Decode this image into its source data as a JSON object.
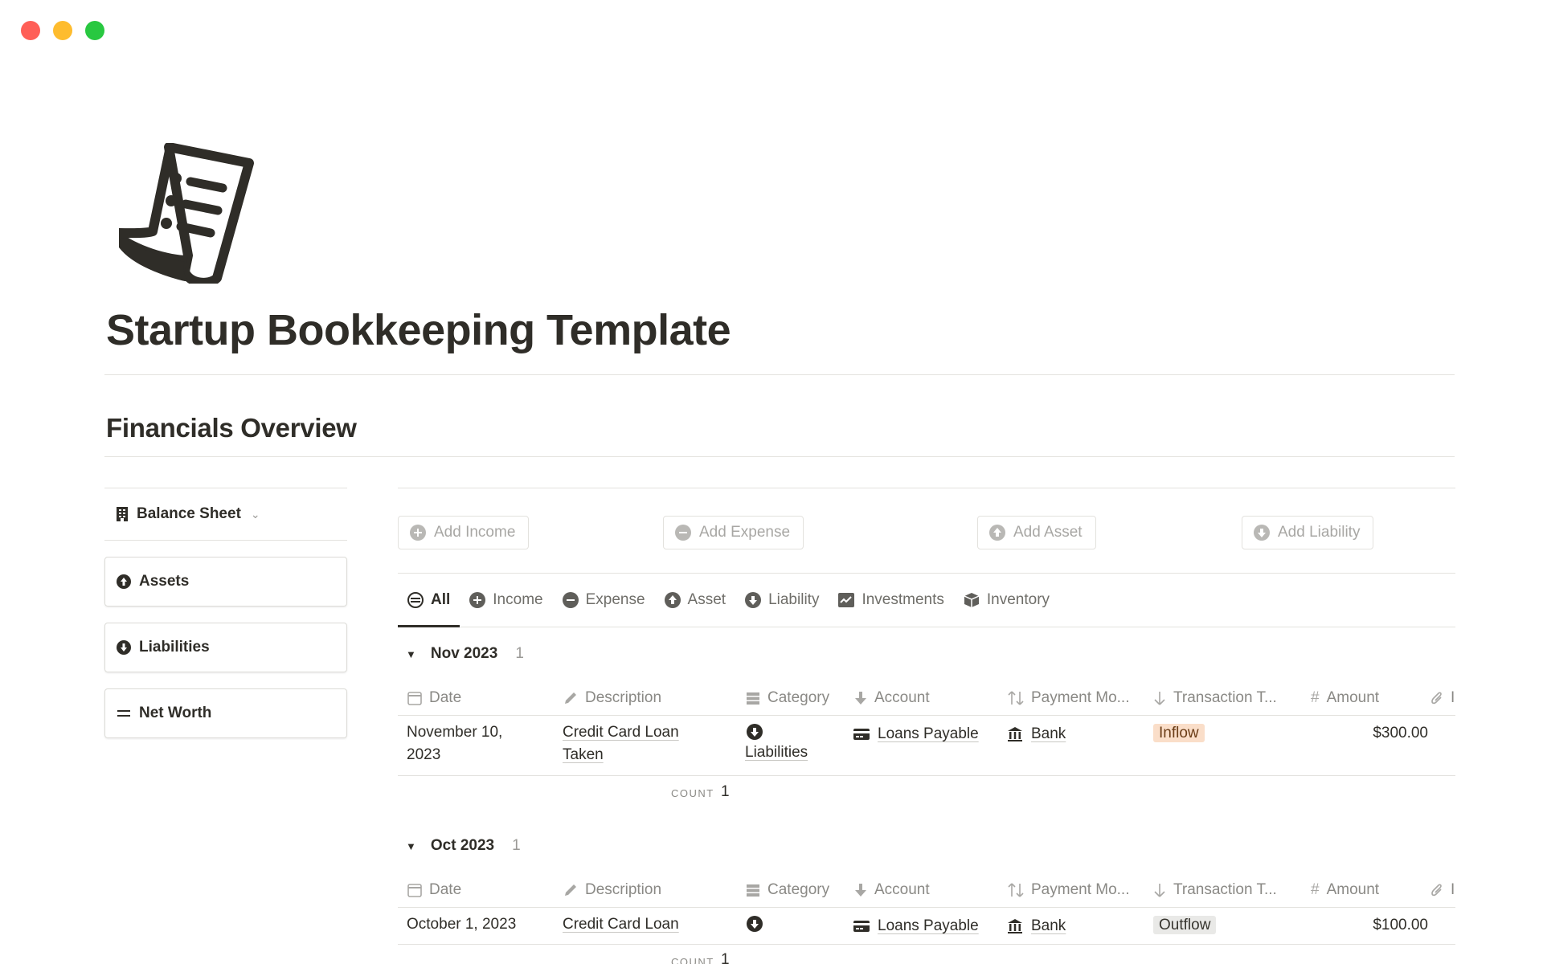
{
  "page": {
    "title": "Startup Bookkeeping Template",
    "section_title": "Financials Overview"
  },
  "sidebar": {
    "balance_sheet_label": "Balance Sheet",
    "items": [
      {
        "label": "Assets",
        "icon": "arrow-up-circle-icon"
      },
      {
        "label": "Liabilities",
        "icon": "arrow-down-circle-icon"
      },
      {
        "label": "Net Worth",
        "icon": "equals-icon"
      }
    ]
  },
  "actions": {
    "add_income": "Add Income",
    "add_expense": "Add Expense",
    "add_asset": "Add Asset",
    "add_liability": "Add Liability"
  },
  "tabs": [
    {
      "label": "All",
      "icon": "stack-icon"
    },
    {
      "label": "Income",
      "icon": "plus-circle-icon"
    },
    {
      "label": "Expense",
      "icon": "minus-circle-icon"
    },
    {
      "label": "Asset",
      "icon": "arrow-up-circle-icon"
    },
    {
      "label": "Liability",
      "icon": "arrow-down-circle-icon"
    },
    {
      "label": "Investments",
      "icon": "chart-icon"
    },
    {
      "label": "Inventory",
      "icon": "box-icon"
    }
  ],
  "columns": {
    "date": "Date",
    "description": "Description",
    "category": "Category",
    "account": "Account",
    "payment": "Payment Mo...",
    "transaction": "Transaction T...",
    "amount": "Amount",
    "files": "I"
  },
  "groups": [
    {
      "name": "Nov 2023",
      "count": "1",
      "row": {
        "date_line1": "November 10,",
        "date_line2": "2023",
        "desc_line1": "Credit Card Loan",
        "desc_line2": "Taken",
        "category": "Liabilities",
        "account": "Loans Payable",
        "payment": "Bank",
        "transaction": "Inflow",
        "amount": "$300.00"
      },
      "count_label": "COUNT",
      "count_value": "1"
    },
    {
      "name": "Oct 2023",
      "count": "1",
      "row": {
        "date": "October 1, 2023",
        "desc_line1": "Credit Card Loan",
        "account": "Loans Payable",
        "payment": "Bank",
        "transaction": "Outflow",
        "amount": "$100.00"
      },
      "count_label": "COUNT",
      "count_value": "1"
    }
  ],
  "colors": {
    "text": "#37352f",
    "muted": "#8a8985",
    "inflow_bg": "#fadec9",
    "outflow_bg": "#e9e9e7"
  }
}
